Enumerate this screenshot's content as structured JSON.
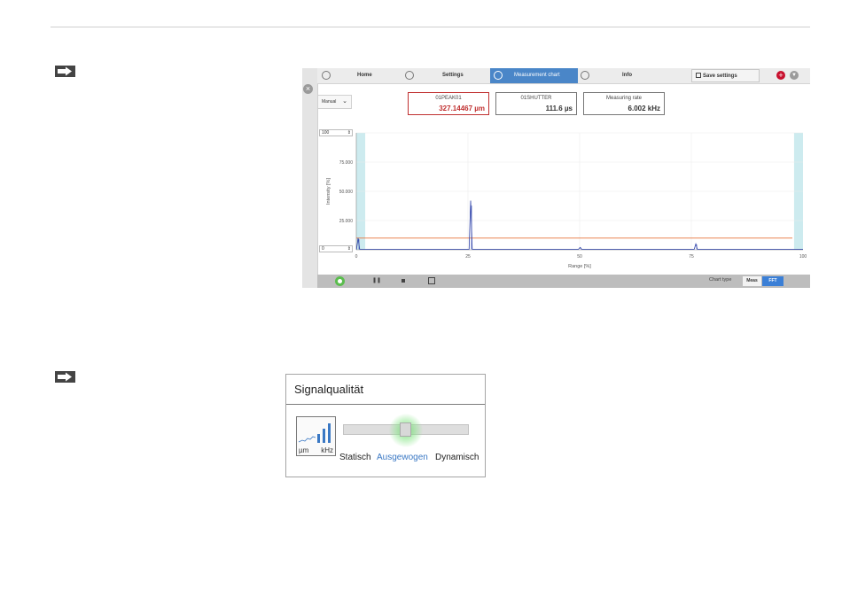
{
  "nav": {
    "home_label": "Home",
    "settings_label": "Settings",
    "chart_label": "Measurement chart",
    "info_label": "Info",
    "save_label": "Save settings"
  },
  "mode_select": {
    "value": "Manual"
  },
  "readouts": [
    {
      "label": "01PEAK01",
      "value": "327.14467 µm",
      "color": "#c03030"
    },
    {
      "label": "01SHUTTER",
      "value": "111.6 µs"
    },
    {
      "label": "Measuring rate",
      "value": "6.002 kHz"
    }
  ],
  "chart_data": {
    "type": "line",
    "xlabel": "Range [%]",
    "ylabel": "Intensity [%]",
    "xlim": [
      0,
      100
    ],
    "ylim": [
      0,
      100
    ],
    "x_ticks": [
      "0",
      "25",
      "50",
      "75",
      "100"
    ],
    "y_ticks": [
      "75.000",
      "50.000",
      "25.000"
    ],
    "y_max_input": "100",
    "y_min_input": "0",
    "threshold": 10,
    "threshold_color": "#e8743b",
    "series_color": "#2b3fa8",
    "masked_left": [
      0,
      2
    ],
    "masked_right": [
      98,
      100
    ],
    "peaks": [
      {
        "x": 0.4,
        "y": 10
      },
      {
        "x": 25.6,
        "y": 42
      },
      {
        "x": 50.1,
        "y": 2
      },
      {
        "x": 76.0,
        "y": 5
      }
    ]
  },
  "toolbar": {
    "chart_type_label": "Chart type",
    "meas_label": "Meas",
    "fft_label": "FFT"
  },
  "signal_panel": {
    "title": "Signalqualität",
    "icon_unit_left": "µm",
    "icon_unit_right": "kHz",
    "options": [
      "Statisch",
      "Ausgewogen",
      "Dynamisch"
    ],
    "selected": "Ausgewogen",
    "accent": "#3a78c4"
  }
}
